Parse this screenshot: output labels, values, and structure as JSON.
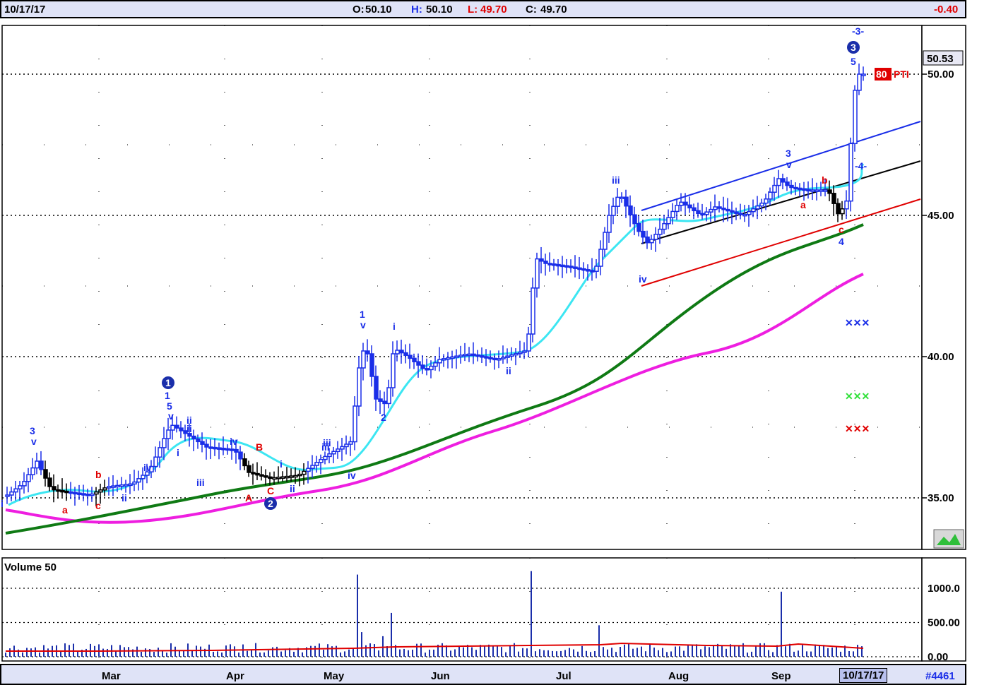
{
  "header": {
    "date": "10/17/17",
    "open_label": "O:",
    "open": "50.10",
    "high_label": "H:",
    "high": "50.10",
    "low_label": "L:",
    "low": "49.70",
    "close_label": "C:",
    "close": "49.70",
    "change": "-0.40"
  },
  "footer": {
    "months": [
      "Mar",
      "Apr",
      "May",
      "Jun",
      "Jul",
      "Aug",
      "Sep"
    ],
    "current_date": "10/17/17",
    "code": "#4461"
  },
  "colors": {
    "price_bars": "#1a2ee8",
    "down_bars": "#000000",
    "ma_short": "#3ce6f2",
    "ma_mid": "#0f7a14",
    "ma_long": "#ee1ee0",
    "upper_channel": "#1a2ee8",
    "mid_channel": "#000000",
    "lower_channel": "#e00000",
    "wave_label": "#1a2ee8",
    "corr_label": "#e00000",
    "volume": "#1a2eaa",
    "volume_avg": "#e00000"
  },
  "chart_data": [
    {
      "type": "candlestick",
      "title": "",
      "ylim": [
        34,
        52
      ],
      "y_ticks": [
        "50.00",
        "45.00",
        "40.00",
        "35.00"
      ],
      "last_price_label": "50.53",
      "price_tag": "80",
      "price_tag_suffix": "PTI",
      "ohlc_samples": [
        {
          "month": "Mar",
          "close": 35.2
        },
        {
          "month": "Apr",
          "close": 37.3
        },
        {
          "month": "Apr",
          "close": 35.6
        },
        {
          "month": "May",
          "close": 40.2
        },
        {
          "month": "Jun",
          "close": 39.9
        },
        {
          "month": "Jul",
          "close": 43.1
        },
        {
          "month": "Aug",
          "close": 45.0
        },
        {
          "month": "Sep",
          "close": 45.8
        },
        {
          "month": "Oct",
          "close": 49.7
        }
      ],
      "wave_labels": [
        "3",
        "v",
        "1",
        "5",
        "v",
        "ii",
        "iii",
        "iv",
        "i",
        "ii",
        "iii",
        "iv",
        "1",
        "v",
        "2",
        "i",
        "ii",
        "iii",
        "iv",
        "3",
        "v",
        "5",
        "-3-",
        "-4-",
        "4",
        "i",
        "ii",
        "iii",
        "iv",
        "ii",
        "i"
      ],
      "correction_labels": [
        "a",
        "b",
        "c",
        "A",
        "B",
        "C",
        "a",
        "b",
        "c"
      ],
      "circled_labels": [
        "1",
        "2",
        "3"
      ],
      "projection_marks": 3
    },
    {
      "type": "bar",
      "title": "Volume 50",
      "ylim": [
        0,
        1200
      ],
      "y_ticks": [
        "1000.0",
        "500.00",
        "0.00"
      ],
      "value_samples": [
        {
          "month": "Mar",
          "value": 120
        },
        {
          "month": "May",
          "value": 1200
        },
        {
          "month": "Jul",
          "value": 1250
        },
        {
          "month": "Sep",
          "value": 950
        }
      ],
      "average_level": 120
    }
  ]
}
